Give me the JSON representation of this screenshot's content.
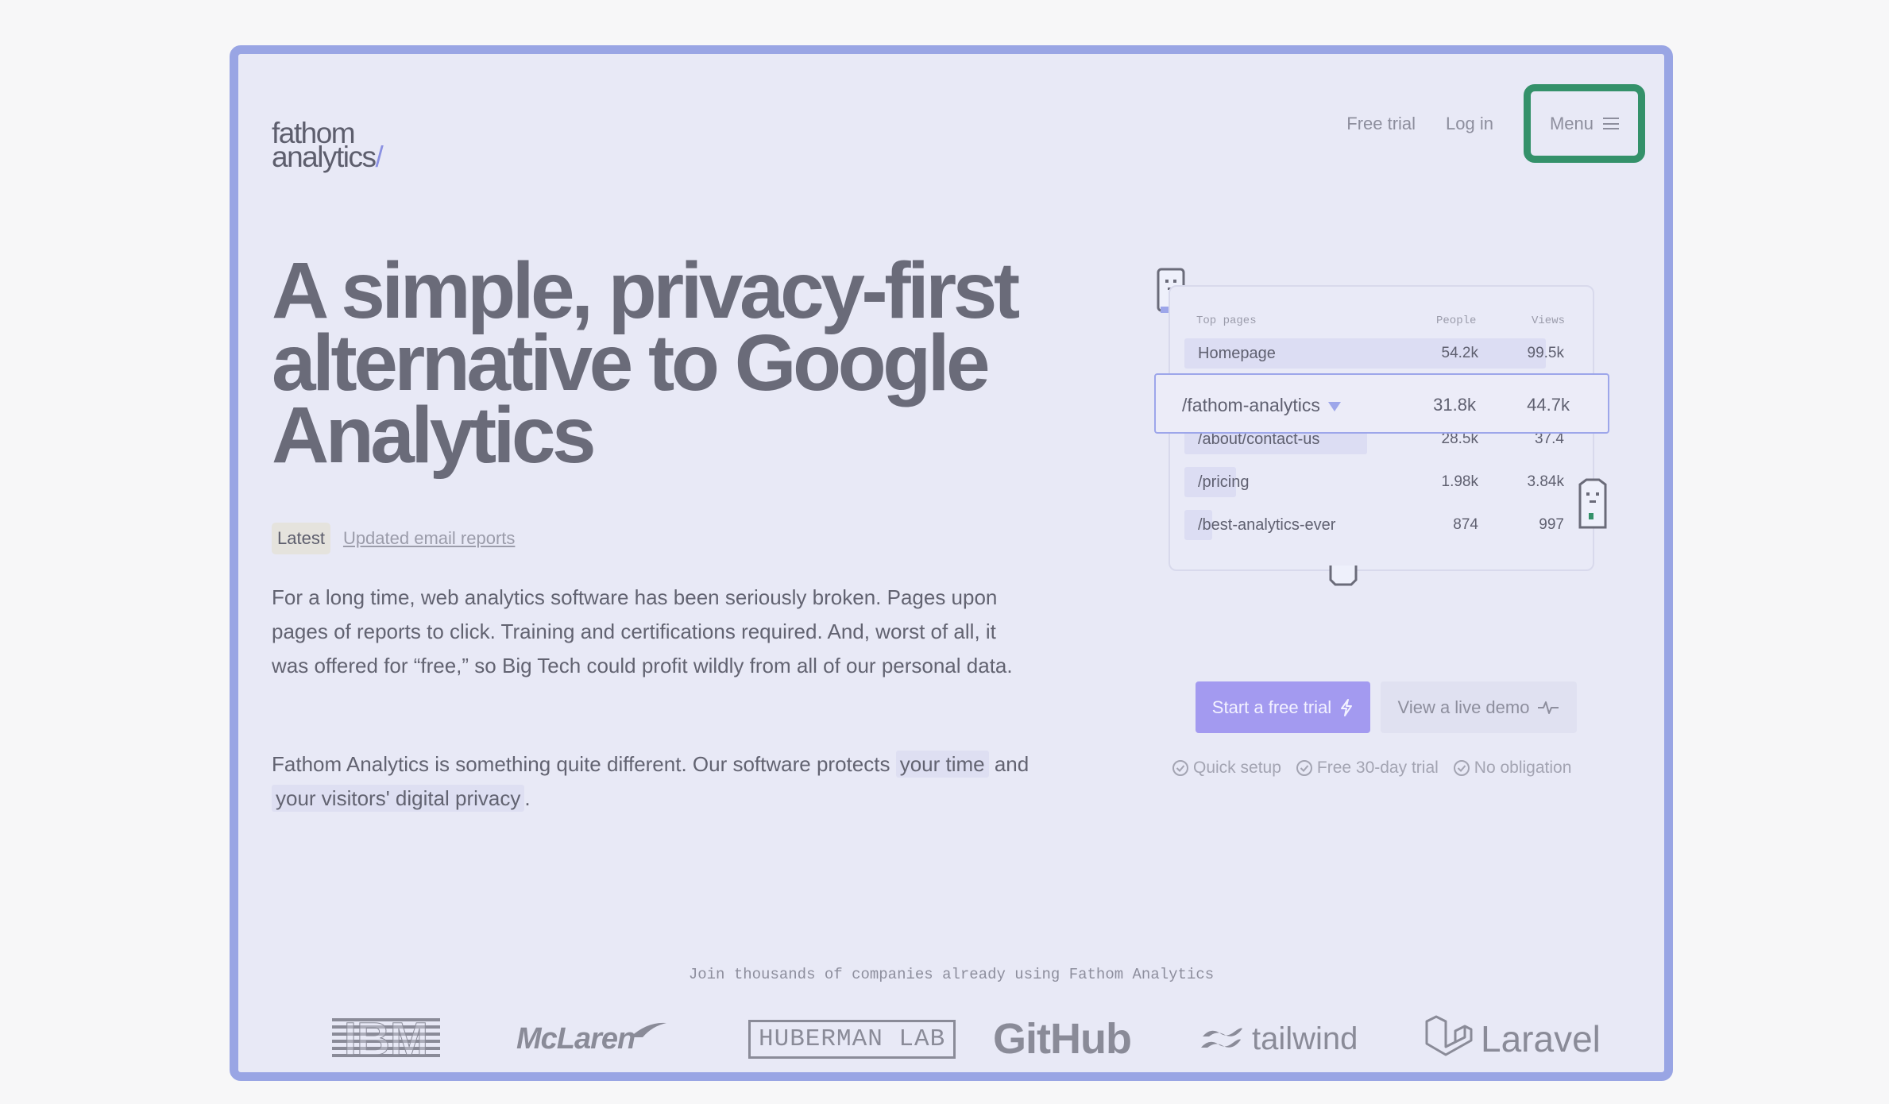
{
  "brand": {
    "line1": "fathom",
    "line2": "analytics",
    "slash": "/"
  },
  "nav": {
    "free_trial": "Free trial",
    "log_in": "Log in",
    "menu": "Menu"
  },
  "hero": {
    "line1": "A simple, privacy-first",
    "line2": "alternative to Google",
    "line3": "Analytics"
  },
  "latest": {
    "badge": "Latest",
    "link": "Updated email reports"
  },
  "body": {
    "p1": "For a long time, web analytics software has been seriously broken. Pages upon pages of reports to click. Training and certifications required. And, worst of all, it was offered for “free,” so Big Tech could profit wildly from all of our personal data.",
    "p2_start": "Fathom Analytics is something quite different. Our software protects",
    "p2_hl1": "your time",
    "p2_mid": "and",
    "p2_hl2": "your visitors' digital privacy",
    "p2_end": "."
  },
  "widget": {
    "col_pages": "Top pages",
    "col_people": "People",
    "col_views": "Views",
    "rows": [
      {
        "page": "Homepage",
        "people": "54.2k",
        "views": "99.5k",
        "bar": 0.91
      },
      {
        "page": "/fathom-analytics",
        "people": "31.8k",
        "views": "44.7k",
        "active": true
      },
      {
        "page": "/about/contact-us",
        "people": "28.5k",
        "views": "37.4",
        "bar": 0.46
      },
      {
        "page": "/pricing",
        "people": "1.98k",
        "views": "3.84k",
        "bar": 0.13
      },
      {
        "page": "/best-analytics-ever",
        "people": "874",
        "views": "997",
        "bar": 0.07
      }
    ]
  },
  "cta": {
    "primary": "Start a free trial",
    "secondary": "View a live demo"
  },
  "checks": [
    "Quick setup",
    "Free 30-day trial",
    "No obligation"
  ],
  "social": {
    "heading": "Join thousands of companies already using Fathom Analytics",
    "logos": [
      "IBM",
      "McLaren",
      "HUBERMAN LAB",
      "GitHub",
      "tailwind",
      "Laravel"
    ]
  },
  "colors": {
    "accent": "#a39af0",
    "frame": "#99a5e4",
    "menu_highlight": "#34916a"
  }
}
